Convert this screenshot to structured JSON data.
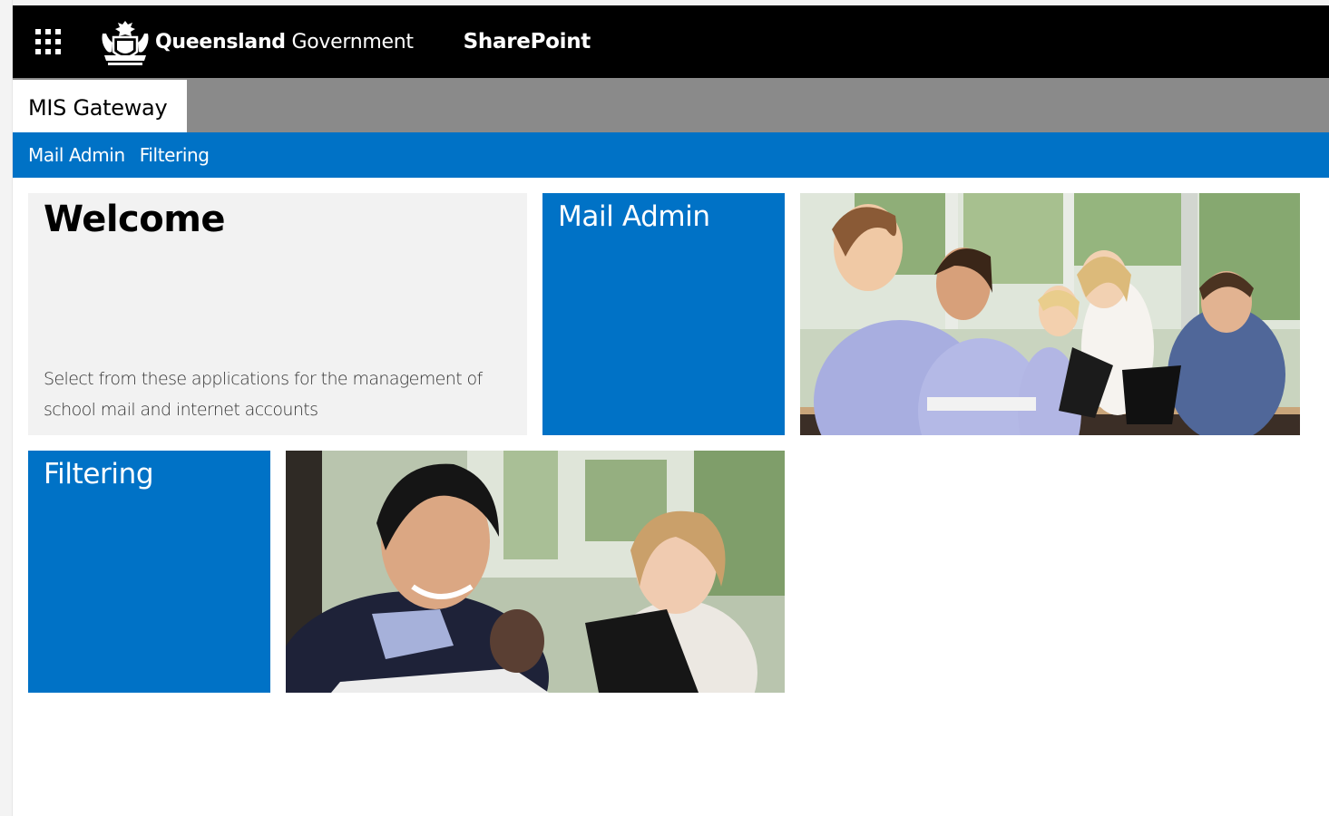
{
  "suite_bar": {
    "brand": {
      "bold": "Queensland",
      "regular": "Government"
    },
    "app_name": "SharePoint"
  },
  "site": {
    "title": "MIS Gateway"
  },
  "nav": {
    "items": [
      "Mail Admin",
      "Filtering"
    ]
  },
  "welcome": {
    "title": "Welcome",
    "description": "Select from these applications for the management of school mail and internet accounts"
  },
  "tiles": [
    {
      "title": "Mail Admin"
    },
    {
      "title": "Filtering"
    }
  ],
  "colors": {
    "suite_bar": "#000000",
    "site_header": "#8a8a8a",
    "nav": "#0072c6",
    "tile_blue": "#0072c6",
    "welcome_bg": "#f2f2f2"
  }
}
